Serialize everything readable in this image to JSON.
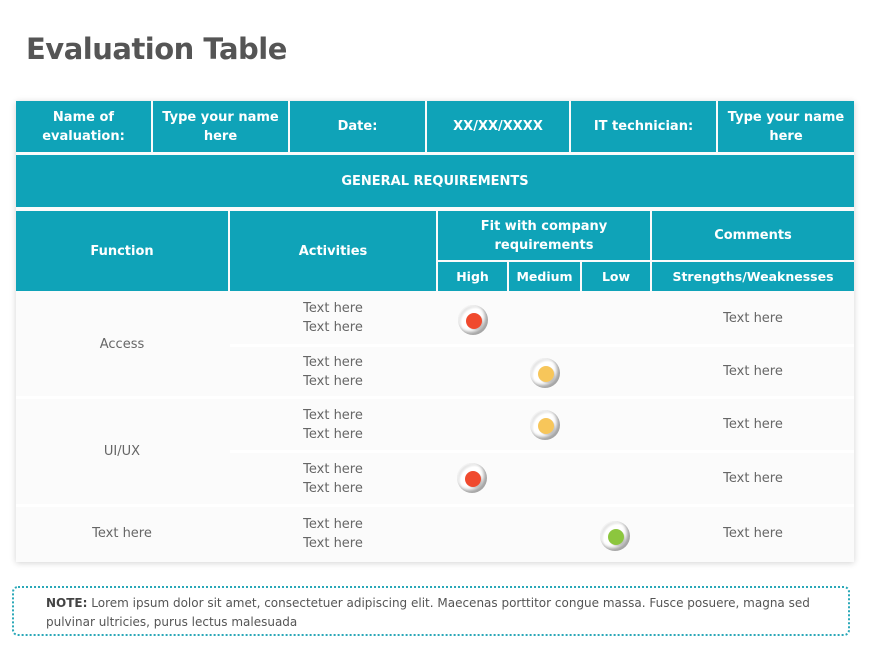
{
  "title": "Evaluation Table",
  "colors": {
    "header_teal": "#0fa3b8",
    "high_red": "#f04a2e",
    "medium_yellow": "#f7c65a",
    "low_green": "#8cc63e"
  },
  "info_row": {
    "name_label": "Name of evaluation:",
    "name_value": "Type your name here",
    "date_label": "Date:",
    "date_value": "XX/XX/XXXX",
    "tech_label": "IT technician:",
    "tech_value": "Type your name here"
  },
  "section_title": "GENERAL REQUIREMENTS",
  "columns": {
    "function": "Function",
    "activities": "Activities",
    "fit": "Fit with company requirements",
    "comments": "Comments",
    "high": "High",
    "medium": "Medium",
    "low": "Low",
    "strengths": "Strengths/Weaknesses"
  },
  "rows": [
    {
      "function": "Access",
      "activity1": "Text here",
      "activity2": "Text here",
      "fit": "High",
      "comment": "Text here"
    },
    {
      "function": "",
      "activity1": "Text here",
      "activity2": "Text here",
      "fit": "Medium",
      "comment": "Text here"
    },
    {
      "function": "UI/UX",
      "activity1": "Text here",
      "activity2": "Text here",
      "fit": "Medium",
      "comment": "Text here"
    },
    {
      "function": "",
      "activity1": "Text here",
      "activity2": "Text here",
      "fit": "High",
      "comment": "Text here"
    },
    {
      "function": "Text here",
      "activity1": "Text here",
      "activity2": "Text here",
      "fit": "Low",
      "comment": "Text here"
    }
  ],
  "note": {
    "label": "NOTE:",
    "text": "Lorem ipsum dolor sit amet, consectetuer adipiscing elit. Maecenas porttitor congue massa. Fusce posuere, magna sed pulvinar ultricies, purus lectus malesuada"
  }
}
